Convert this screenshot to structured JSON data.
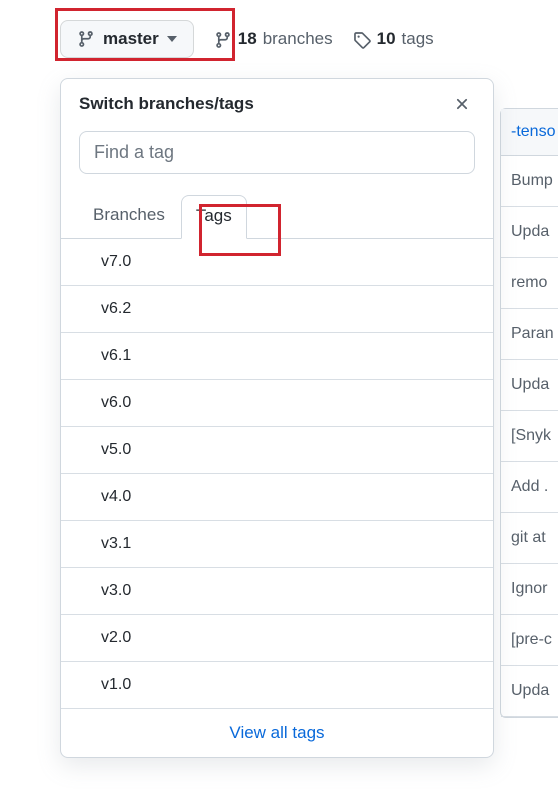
{
  "branch_selector": {
    "current": "master"
  },
  "stats": {
    "branches_count": "18",
    "branches_label": "branches",
    "tags_count": "10",
    "tags_label": "tags"
  },
  "dropdown": {
    "title": "Switch branches/tags",
    "search_placeholder": "Find a tag",
    "tabs": {
      "branches": "Branches",
      "tags": "Tags"
    },
    "tags": [
      "v7.0",
      "v6.2",
      "v6.1",
      "v6.0",
      "v5.0",
      "v4.0",
      "v3.1",
      "v3.0",
      "v2.0",
      "v1.0"
    ],
    "view_all": "View all tags"
  },
  "background_rows": {
    "header": "-tenso",
    "rows": [
      "Bump",
      "Upda",
      "remo",
      "Paran",
      "Upda",
      "[Snyk",
      "Add .",
      "git at",
      "Ignor",
      "[pre-c",
      "Upda"
    ]
  },
  "colors": {
    "link": "#0969da",
    "border": "#d0d7de",
    "muted": "#57606a"
  }
}
